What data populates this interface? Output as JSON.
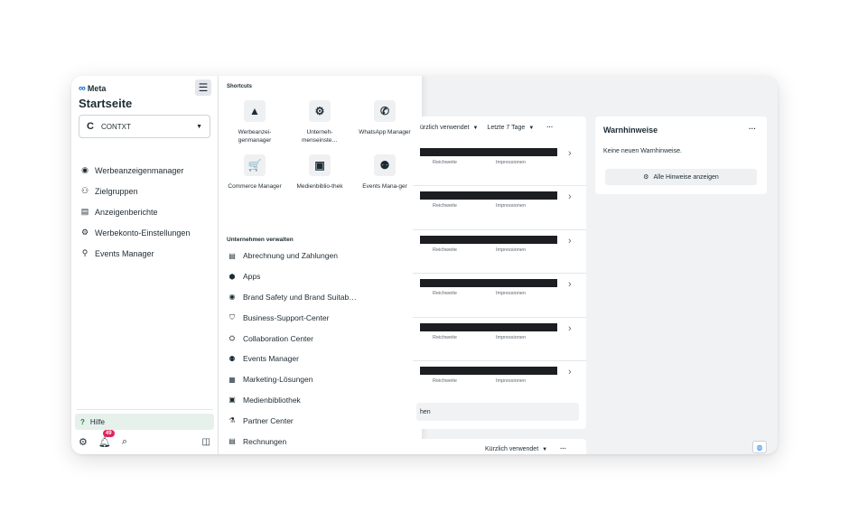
{
  "brand": {
    "logo_symbol": "∞",
    "name": "Meta"
  },
  "sidebar": {
    "title": "Startseite",
    "account": {
      "icon": "contxt-logo-icon",
      "name": "CONTXT"
    },
    "nav": [
      {
        "icon": "ads-manager-icon",
        "glyph": "◉",
        "label": "Werbeanzeigenmanager"
      },
      {
        "icon": "audiences-icon",
        "glyph": "⚇",
        "label": "Zielgruppen"
      },
      {
        "icon": "ads-reporting-icon",
        "glyph": "▤",
        "label": "Anzeigenberichte"
      },
      {
        "icon": "ad-account-settings-icon",
        "glyph": "⚙",
        "label": "Werbekonto-Einstellungen"
      },
      {
        "icon": "events-manager-icon",
        "glyph": "⚲",
        "label": "Events Manager"
      }
    ],
    "help_label": "Hilfe",
    "notification_count": "49"
  },
  "shortcuts": {
    "heading": "Shortcuts",
    "items": [
      {
        "icon": "ads-manager-icon",
        "glyph": "▲",
        "label": "Werbeanzei-genmanager"
      },
      {
        "icon": "business-settings-icon",
        "glyph": "⚙",
        "label": "Unterneh-menseinste…"
      },
      {
        "icon": "whatsapp-icon",
        "glyph": "✆",
        "label": "WhatsApp Manager"
      },
      {
        "icon": "commerce-manager-icon",
        "glyph": "🛒",
        "label": "Commerce Manager"
      },
      {
        "icon": "media-library-icon",
        "glyph": "▣",
        "label": "Medienbiblio-thek"
      },
      {
        "icon": "events-manager-icon",
        "glyph": "⚉",
        "label": "Events Mana-ger"
      }
    ]
  },
  "manage": {
    "heading": "Unternehmen verwalten",
    "items": [
      {
        "icon": "billing-icon",
        "glyph": "▤",
        "label": "Abrechnung und Zahlungen"
      },
      {
        "icon": "apps-icon",
        "glyph": "⬢",
        "label": "Apps"
      },
      {
        "icon": "brand-safety-icon",
        "glyph": "◉",
        "label": "Brand Safety und Brand Suitab…"
      },
      {
        "icon": "business-support-icon",
        "glyph": "⛉",
        "label": "Business-Support-Center"
      },
      {
        "icon": "collaboration-center-icon",
        "glyph": "⛭",
        "label": "Collaboration Center"
      },
      {
        "icon": "events-manager-icon",
        "glyph": "⚉",
        "label": "Events Manager"
      },
      {
        "icon": "marketing-solutions-icon",
        "glyph": "▦",
        "label": "Marketing-Lösungen"
      },
      {
        "icon": "media-library-icon",
        "glyph": "▣",
        "label": "Medienbibliothek"
      },
      {
        "icon": "partner-center-icon",
        "glyph": "⚗",
        "label": "Partner Center"
      },
      {
        "icon": "invoices-icon",
        "glyph": "▤",
        "label": "Rechnungen"
      }
    ]
  },
  "main": {
    "filter_recent": "ürzlich verwendet",
    "filter_period": "Letzte 7 Tage",
    "rows": [
      {
        "metric1": "Reichweite",
        "metric2": "Impressionen"
      },
      {
        "metric1": "Reichweite",
        "metric2": "Impressionen"
      },
      {
        "metric1": "Reichweite",
        "metric2": "Impressionen"
      },
      {
        "metric1": "Reichweite",
        "metric2": "Impressionen"
      },
      {
        "metric1": "Reichweite",
        "metric2": "Impressionen"
      },
      {
        "metric1": "Reichweite",
        "metric2": "Impressionen"
      }
    ],
    "see_more": "hen",
    "bottom_filter": "Kürzlich verwendet"
  },
  "warnings": {
    "title": "Warnhinweise",
    "empty_text": "Keine neuen Warnhinweise.",
    "button_label": "Alle Hinweise anzeigen"
  }
}
